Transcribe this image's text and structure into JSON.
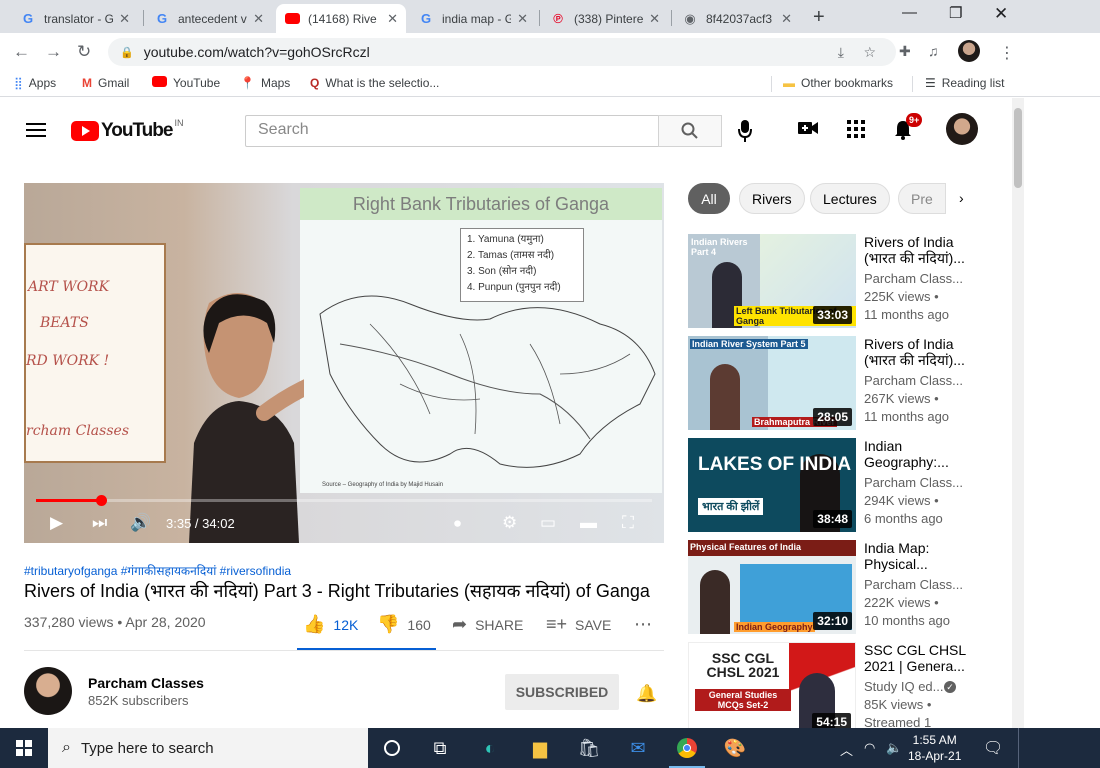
{
  "browser": {
    "tabs": [
      {
        "title": "translator - G",
        "icon": "google-icon"
      },
      {
        "title": "antecedent v",
        "icon": "google-icon"
      },
      {
        "title": "(14168) Rive",
        "icon": "youtube-icon"
      },
      {
        "title": "india map - G",
        "icon": "google-icon"
      },
      {
        "title": "(338) Pintere",
        "icon": "pinterest-icon"
      },
      {
        "title": "8f42037acf3",
        "icon": "globe-icon"
      }
    ],
    "url": "youtube.com/watch?v=gohOSrcRczl",
    "bookmarks": [
      "Apps",
      "Gmail",
      "YouTube",
      "Maps",
      "What is the selectio..."
    ],
    "other_bookmarks": "Other bookmarks",
    "reading_list": "Reading list"
  },
  "youtube": {
    "logo_text": "YouTube",
    "country_code": "IN",
    "search_placeholder": "Search",
    "notification_count": "9+"
  },
  "player": {
    "slide_title": "Right Bank Tributaries of Ganga",
    "tributaries": [
      "1. Yamuna (यमुना)",
      "2. Tamas (तामस नदी)",
      "3. Son (सोन नदी)",
      "4. Punpun (पुनपुन नदी)"
    ],
    "source_note": "Source – Geography of India by Majid Husain",
    "board_text": [
      "ART WORK",
      "BEATS",
      "RD WORK !",
      "rcham Classes"
    ],
    "time": "3:35 / 34:02",
    "progress": 0.105
  },
  "video": {
    "hashtags": "#tributaryofganga #गंगाकीसहायकनदियां #riversofindia",
    "title": "Rivers of India (भारत की नदियां) Part 3 - Right Tributaries (सहायक नदियां) of Ganga",
    "views_date": "337,280 views • Apr 28, 2020",
    "likes": "12K",
    "dislikes": "160",
    "share": "SHARE",
    "save": "SAVE",
    "channel": "Parcham Classes",
    "subscribers": "852K subscribers",
    "subscribe_label": "SUBSCRIBED"
  },
  "chips": [
    "All",
    "Rivers",
    "Lectures",
    "Pre"
  ],
  "recommendations": [
    {
      "title": "Rivers of India (भारत की नदियां)...",
      "channel": "Parcham Class...",
      "views": "225K views •",
      "age": "11 months ago",
      "duration": "33:03",
      "thumb_top": "Indian Rivers Part 4",
      "thumb_bottom": "Left Bank Tributaries of Ganga",
      "accent": "#d7eaf2"
    },
    {
      "title": "Rivers of India (भारत की नदियां)...",
      "channel": "Parcham Class...",
      "views": "267K views •",
      "age": "11 months ago",
      "duration": "28:05",
      "thumb_top": "Indian River System Part 5",
      "thumb_bottom": "Brahmaputra River",
      "accent": "#cfe8ef"
    },
    {
      "title": "Indian Geography:...",
      "channel": "Parcham Class...",
      "views": "294K views •",
      "age": "6 months ago",
      "duration": "38:48",
      "thumb_top": "LAKES OF INDIA",
      "thumb_bottom": "भारत की झीलें",
      "accent": "#0d4a5e"
    },
    {
      "title": "India Map: Physical...",
      "channel": "Parcham Class...",
      "views": "222K views •",
      "age": "10 months ago",
      "duration": "32:10",
      "thumb_top": "Physical Features of India",
      "thumb_bottom": "Indian Geography",
      "accent": "#e9eef0"
    },
    {
      "title": "SSC CGL CHSL 2021 | Genera...",
      "channel": "Study IQ ed...",
      "views": "85K views •",
      "age": "Streamed 1",
      "duration": "54:15",
      "thumb_top": "SSC CGL CHSL 2021",
      "thumb_bottom": "General Studies MCQs Set-2",
      "accent": "#ffffff"
    }
  ],
  "taskbar": {
    "search_placeholder": "Type here to search",
    "time": "1:55 AM",
    "date": "18-Apr-21"
  }
}
